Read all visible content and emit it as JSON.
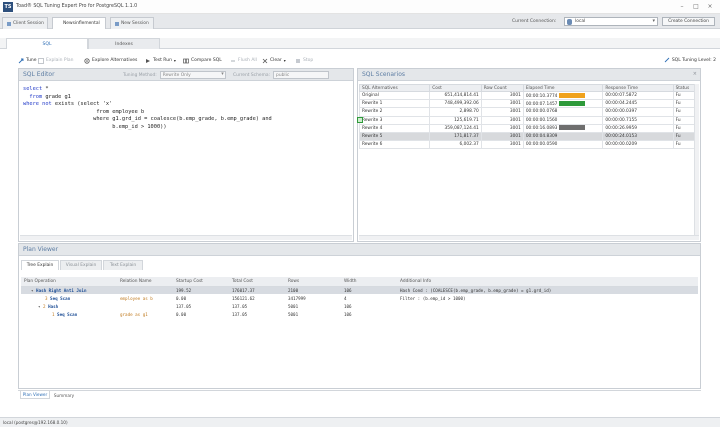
{
  "window": {
    "title": "Toad® SQL Tuning Expert Pro for PostgreSQL 1.1.0",
    "app_icon": "TS"
  },
  "sessions": {
    "tabs": [
      {
        "label": "Client Session"
      },
      {
        "label": "Newsinflemental"
      },
      {
        "label": "New Session"
      }
    ],
    "current_connection_label": "Current Connection:",
    "current_connection_value": "local",
    "connect_button": "Create Connection"
  },
  "subtabs": {
    "sql": "SQL",
    "indexes": "Indexes"
  },
  "toolbar": {
    "tune": "Tune",
    "explain_plan": "Explain Plan",
    "explore_alternatives": "Explore Alternatives",
    "test_run": "Test Run",
    "compare_sql": "Compare SQL",
    "flush_all": "Flush All",
    "clear": "Clear",
    "stop": "Stop",
    "tuning_level": "SQL Tuning Level: 2"
  },
  "editor": {
    "title": "SQL Editor",
    "tuning_method_label": "Tuning Method:",
    "tuning_method_value": "Rewrite Only",
    "current_schema_label": "Current Schema:",
    "current_schema_value": "public",
    "lines": [
      {
        "kw": "select",
        "text": " *"
      },
      {
        "kw": "  from",
        "text": " grade g1"
      },
      {
        "kw": "where not",
        "text": " exists (select 'x'"
      },
      {
        "kw": "",
        "text": "                       from employee b"
      },
      {
        "kw": "",
        "text": "                      where g1.grd_id = coalesce(b.emp_grade, b.emp_grade) and"
      },
      {
        "kw": "",
        "text": "                            b.emp_id > 1000))"
      }
    ]
  },
  "scenarios": {
    "title": "SQL Scenarios",
    "columns": [
      "SQL Alternatives",
      "Cost",
      "Row Count",
      "Elapsed Time",
      "Response Time",
      "Status"
    ],
    "rows": [
      {
        "name": "Original",
        "cost": "651,414,814.41",
        "rows": "3001",
        "elapsed": "00:00:10.3774",
        "response": "00:00:07.5872",
        "status": "Fu",
        "bar": "#f0a21c"
      },
      {
        "name": "Rewrite 1",
        "cost": "748,499,392.06",
        "rows": "3001",
        "elapsed": "00:00:07.1457",
        "response": "00:00:04.2445",
        "status": "Fu",
        "bar": "#2e9a3a"
      },
      {
        "name": "Rewrite 2",
        "cost": "2,898.70",
        "rows": "3001",
        "elapsed": "00:00:00.0768",
        "response": "00:00:00.0397",
        "status": "Fu",
        "bar": ""
      },
      {
        "name": "Rewrite 3",
        "cost": "125,619.71",
        "rows": "3001",
        "elapsed": "00:00:00.1560",
        "response": "00:00:00.7155",
        "status": "Fu",
        "bar": ""
      },
      {
        "name": "Rewrite 4",
        "cost": "359,087,124.41",
        "rows": "3001",
        "elapsed": "00:00:16.0893",
        "response": "00:00:26.9959",
        "status": "Fu",
        "bar": "#6e6e6e"
      },
      {
        "name": "Rewrite 5",
        "cost": "171,817.37",
        "rows": "3001",
        "elapsed": "00:00:04.8309",
        "response": "00:00:24.0153",
        "status": "Fu",
        "bar": ""
      },
      {
        "name": "Rewrite 6",
        "cost": "6,002.37",
        "rows": "3001",
        "elapsed": "00:00:00.0590",
        "response": "00:00:00.0209",
        "status": "Fu",
        "bar": ""
      }
    ],
    "selected_index": 5,
    "checked_index": 2
  },
  "plan_viewer": {
    "title": "Plan Viewer",
    "tabs": [
      "Tree Explain",
      "Visual Explain",
      "Text Explain"
    ],
    "columns": [
      "Plan Operation",
      "Relation Name",
      "Startup Cost",
      "Total Cost",
      "Rows",
      "Width",
      "Additional Info"
    ],
    "rows": [
      {
        "tag": "",
        "indent": 1,
        "op": "Hash Right Anti Join",
        "relation": "",
        "startup": "199.52",
        "total": "176017.37",
        "rows": "2100",
        "width": "106",
        "info": "Hash Cond : (COALESCE(b.emp_grade, b.emp_grade) = g1.grd_id)"
      },
      {
        "tag": "3",
        "indent": 3,
        "op": "Seq Scan",
        "relation": "employee as b",
        "startup": "0.00",
        "total": "156121.62",
        "rows": "3417999",
        "width": "4",
        "info": "Filter : (b.emp_id > 1000)"
      },
      {
        "tag": "2",
        "indent": 2,
        "op": "Hash",
        "relation": "",
        "startup": "137.05",
        "total": "137.05",
        "rows": "5001",
        "width": "106",
        "info": ""
      },
      {
        "tag": "1",
        "indent": 4,
        "op": "Seq Scan",
        "relation": "grade as g1",
        "startup": "0.00",
        "total": "137.05",
        "rows": "5001",
        "width": "106",
        "info": ""
      }
    ]
  },
  "bottom_tabs": [
    "Plan Viewer",
    "Summary"
  ],
  "status": "local (postgres@192.168.0.10)"
}
